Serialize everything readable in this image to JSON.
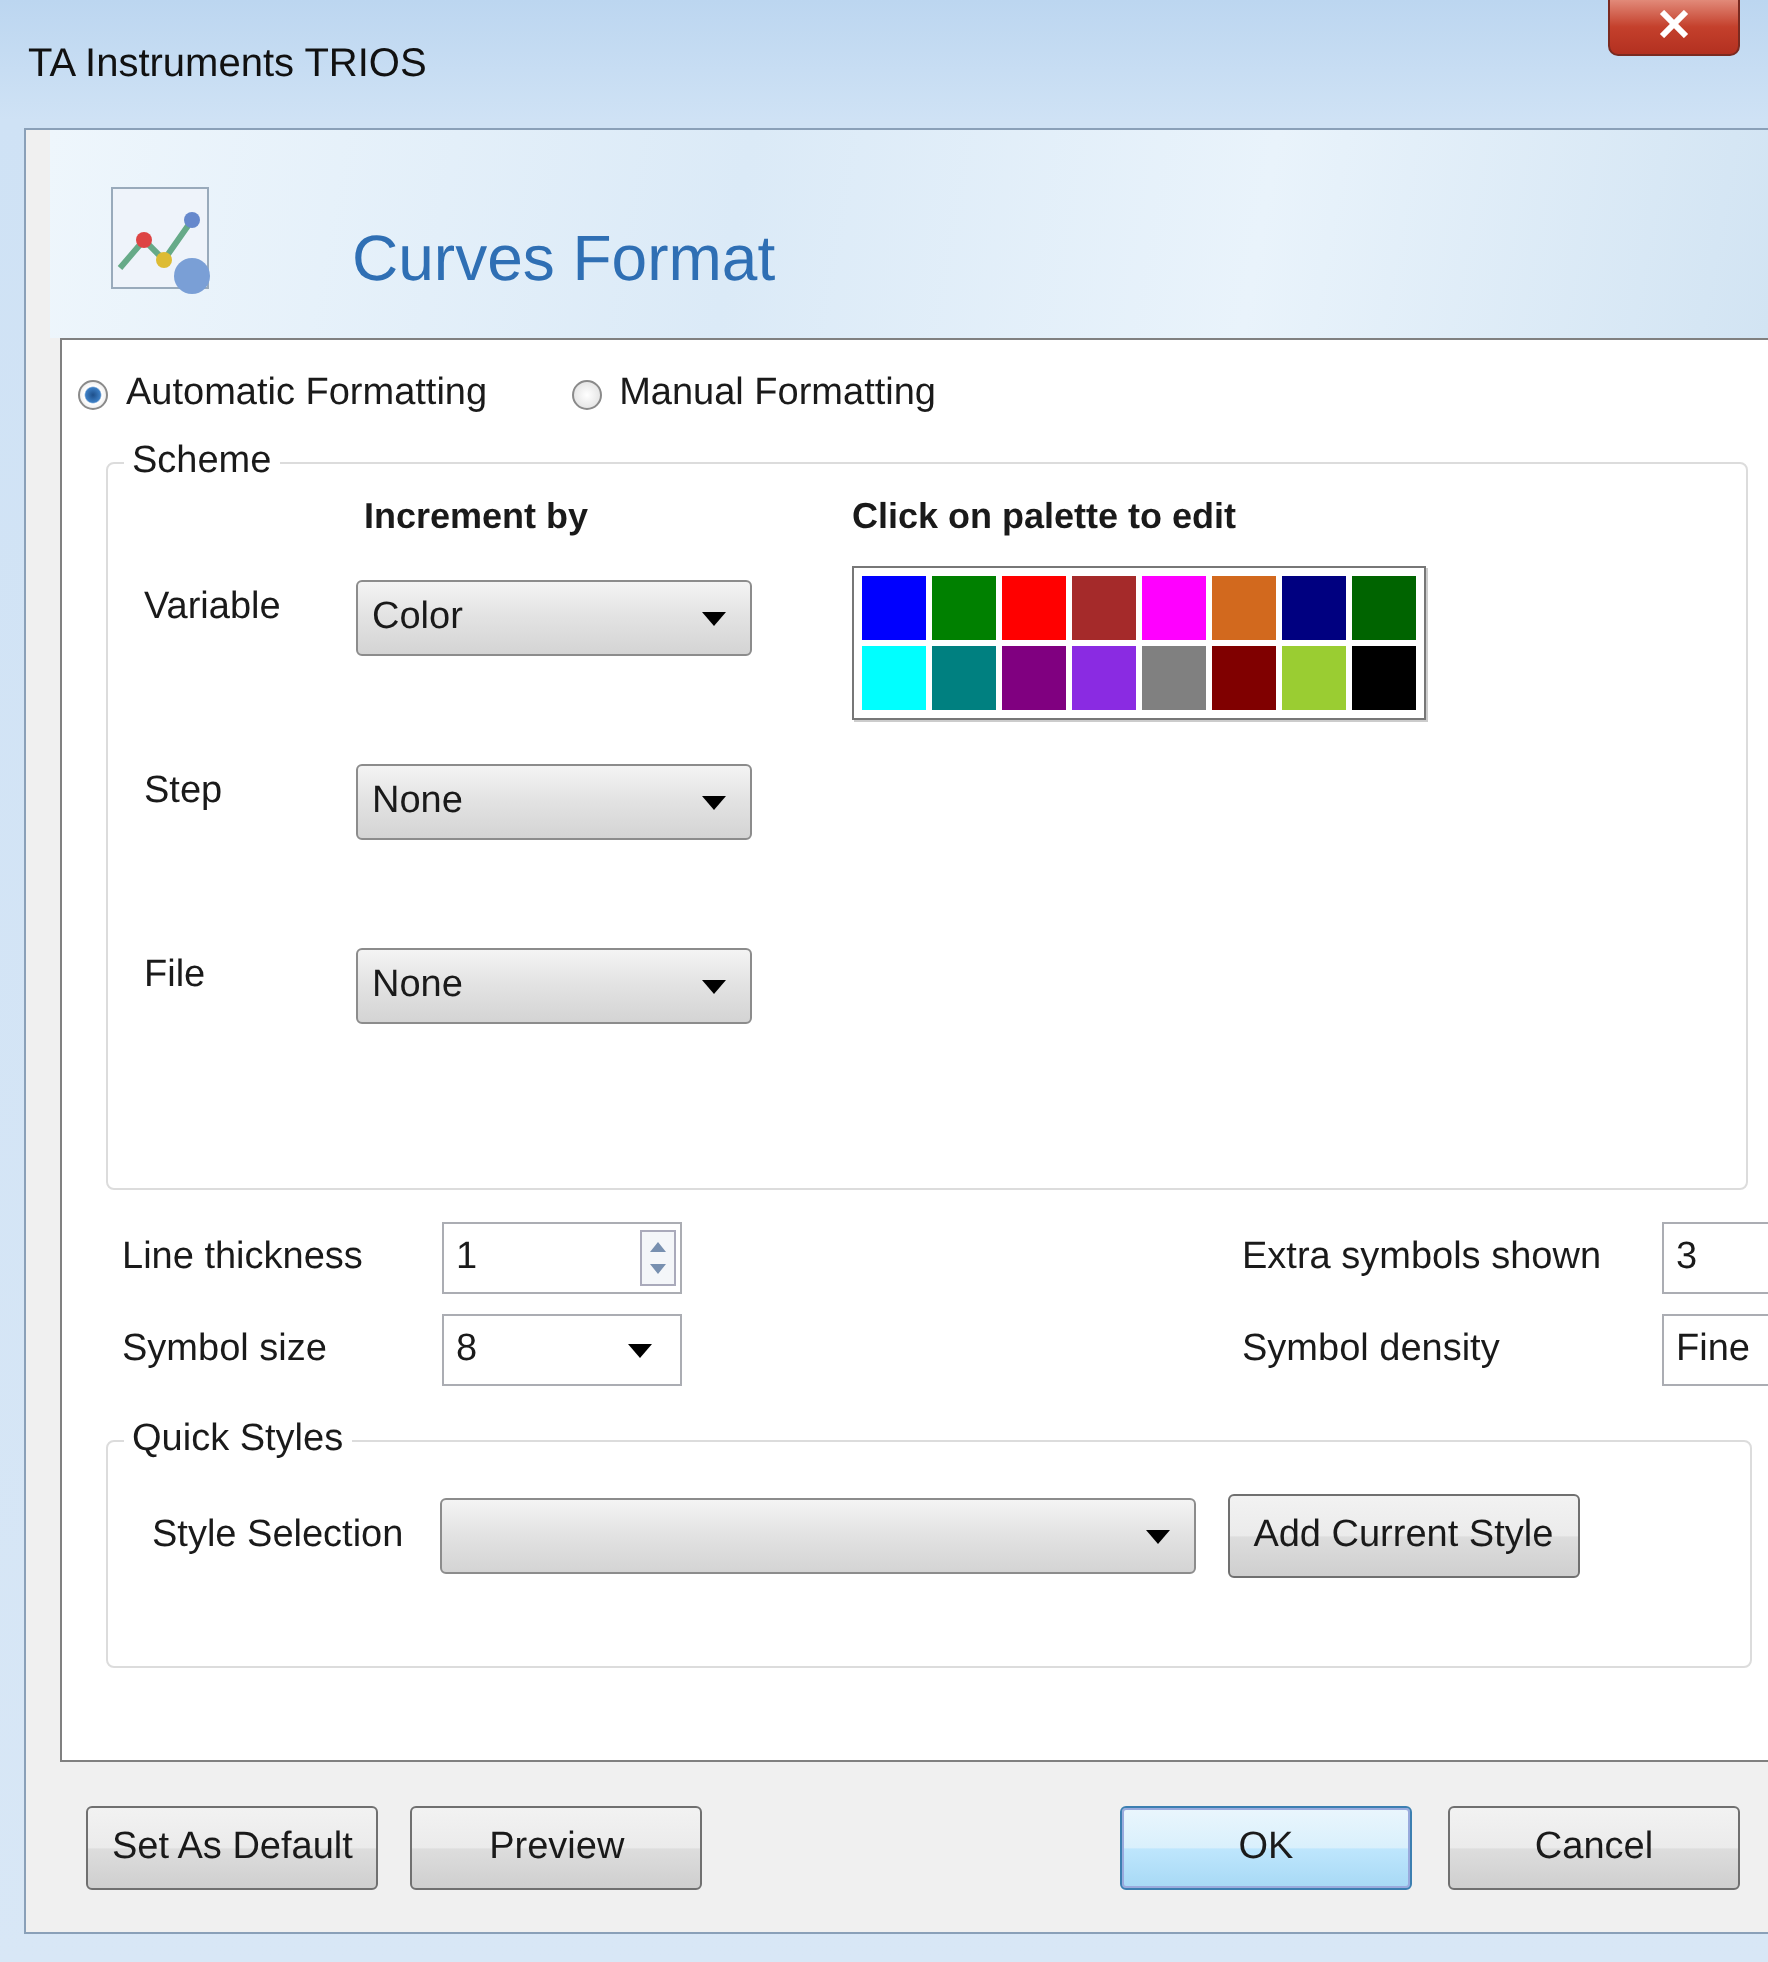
{
  "window": {
    "title": "TA Instruments TRIOS"
  },
  "header": {
    "title": "Curves Format"
  },
  "formatting_modes": [
    {
      "label": "Automatic Formatting",
      "selected": true
    },
    {
      "label": "Manual Formatting",
      "selected": false
    }
  ],
  "scheme": {
    "title": "Scheme",
    "increment_heading": "Increment by",
    "palette_heading": "Click on palette to edit",
    "rows": [
      {
        "label": "Variable",
        "value": "Color"
      },
      {
        "label": "Step",
        "value": "None"
      },
      {
        "label": "File",
        "value": "None"
      }
    ],
    "palette": [
      {
        "color": "#0000ff"
      },
      {
        "color": "#008000"
      },
      {
        "color": "#ff0000"
      },
      {
        "color": "#a52a2a"
      },
      {
        "color": "#ff00ff"
      },
      {
        "color": "#d2691e"
      },
      {
        "color": "#000080"
      },
      {
        "color": "#006400"
      },
      {
        "color": "#00ffff"
      },
      {
        "color": "#008080"
      },
      {
        "color": "#800080"
      },
      {
        "color": "#8a2be2"
      },
      {
        "color": "#808080"
      },
      {
        "color": "#800000"
      },
      {
        "color": "#9acd32"
      },
      {
        "color": "#000000"
      }
    ]
  },
  "settings": [
    {
      "label": "Line thickness",
      "value": "1",
      "kind": "spinner"
    },
    {
      "label": "Extra symbols shown",
      "value": "3",
      "kind": "text"
    },
    {
      "label": "Symbol size",
      "value": "8",
      "kind": "dropdown"
    },
    {
      "label": "Symbol density",
      "value": "Fine",
      "kind": "dropdown"
    }
  ],
  "quick_styles": {
    "title": "Quick Styles",
    "label": "Style Selection",
    "button": "Add Current Style"
  },
  "buttons": [
    {
      "label": "Set As Default",
      "default": false
    },
    {
      "label": "Preview",
      "default": false
    },
    {
      "label": "OK",
      "default": true
    },
    {
      "label": "Cancel",
      "default": false
    }
  ]
}
